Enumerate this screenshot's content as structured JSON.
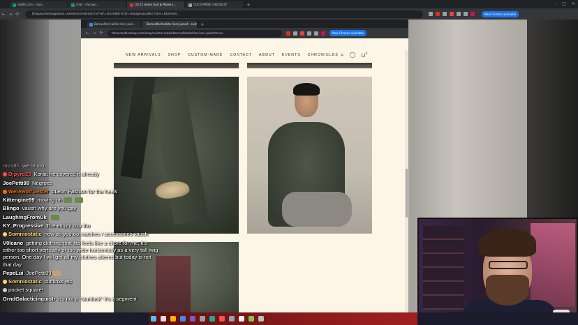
{
  "outer_browser": {
    "tabs": [
      {
        "label": "reddit.com – moo...",
        "color": "#0f9d58"
      },
      {
        "label": "chat – chicago...",
        "color": "#0f9d58"
      },
      {
        "label": "(3) 51 Green Suit & Modern...",
        "color": "#d93025"
      },
      {
        "label": "COCO MADE CHECKLIST",
        "color": "#9aa0a6"
      }
    ],
    "url": "thegauchemagazine.com/en/content/s?cv?ref=chcm&fs?ctrt=moogsvaco8cc?ctrs=1&sheet..."
  },
  "inner_browser": {
    "tabs": [
      {
        "label": "Bamvolford white linen jack...",
        "color": "#4285f4"
      },
      {
        "label": "Bamvolford white linen jacket - custo...",
        "color": "#e8a23a"
      }
    ],
    "url": "thenonesfaceshop.com/shop/custom-made/bamvolford/white-linen-jacket/trees...",
    "cta": "New Chrome available"
  },
  "site": {
    "nav": [
      "NEW ARRIVALS",
      "SHOP",
      "CUSTOM-MADE",
      "CONTACT",
      "ABOUT",
      "EVENTS",
      "CHRONICLES"
    ],
    "icons": [
      "search-icon",
      "account-icon",
      "cart-icon"
    ],
    "cart_count": "0"
  },
  "chat": [
    {
      "user": "mcs8h",
      "color": "#aaaaaa",
      "msg": "we re mo..."
    },
    {
      "user": "Djpyro23",
      "color": "#ff4d4d",
      "msg": "Korau he covered it already"
    },
    {
      "user": "JoePetti99",
      "color": "#ffffff",
      "msg": "Negroes"
    },
    {
      "user": "Werewolf Jester",
      "color": "#ff6a00",
      "msg": "oLeon Fashion for the heels"
    },
    {
      "user": "Kittengine99",
      "color": "#ffffff",
      "msg": "moving on"
    },
    {
      "user": "Blingo",
      "color": "#ffffff",
      "msg": "vaush why are you gay"
    },
    {
      "user": "LaughingFromUk",
      "color": "#ffffff",
      "msg": ""
    },
    {
      "user": "KY_Progressive",
      "color": "#ffffff",
      "msg": "The empty cup tho"
    },
    {
      "user": "Somniostatic",
      "color": "#ffd966",
      "msg": "how do you do watches / accessories vaush"
    },
    {
      "user": "V0lcano",
      "color": "#ffffff",
      "msg": "getting clothing that fits feels like a chore for me, it's either too short vertically or too wide horizontally as a very tall twig person. One day I will get all my clothes altered but today is not that day"
    },
    {
      "user": "PepeLui",
      "color": "#ffffff",
      "msg": "JoePetti99"
    },
    {
      "user": "Somniostatic",
      "color": "#ffd966",
      "msg": "cufflinks etc"
    },
    {
      "user": "",
      "color": "#ffffff",
      "msg": "pocket square!"
    },
    {
      "user": "GrndGalacticinquistr",
      "color": "#ffffff",
      "msg": "it's not a \"stunlock\" it's a segment"
    }
  ]
}
